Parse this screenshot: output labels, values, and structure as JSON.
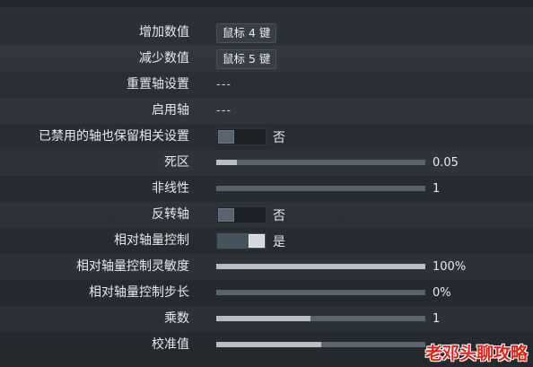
{
  "settings": {
    "increase_value": {
      "label": "增加数值",
      "key": "鼠标 4 键"
    },
    "decrease_value": {
      "label": "减少数值",
      "key": "鼠标 5 键"
    },
    "reset_axis": {
      "label": "重置轴设置",
      "value": "---"
    },
    "enable_axis": {
      "label": "启用轴",
      "value": "---"
    },
    "keep_disabled_axis": {
      "label": "已禁用的轴也保留相关设置",
      "state": "否",
      "on": false
    },
    "dead_zone": {
      "label": "死区",
      "value": "0.05",
      "fill_fraction": 0.1
    },
    "nonlinearity": {
      "label": "非线性",
      "value": "1",
      "fill_fraction": 0.0
    },
    "invert_axis": {
      "label": "反转轴",
      "state": "否",
      "on": false
    },
    "relative_control": {
      "label": "相对轴量控制",
      "state": "是",
      "on": true
    },
    "relative_sensitivity": {
      "label": "相对轴量控制灵敏度",
      "value": "100%",
      "fill_fraction": 1.0
    },
    "relative_step": {
      "label": "相对轴量控制步长",
      "value": "0%",
      "fill_fraction": 0.0
    },
    "multiplier": {
      "label": "乘数",
      "value": "1",
      "fill_fraction": 0.45
    },
    "calibration": {
      "label": "校准值",
      "fill_fraction": 0.5
    }
  },
  "watermark": {
    "text": "老邓头聊攻略",
    "color": "#e0241b"
  },
  "colors": {
    "background": "#2b3137",
    "slider_track": "#5b636b",
    "slider_fill": "#b9bec3",
    "toggle_on": "#46525c"
  }
}
